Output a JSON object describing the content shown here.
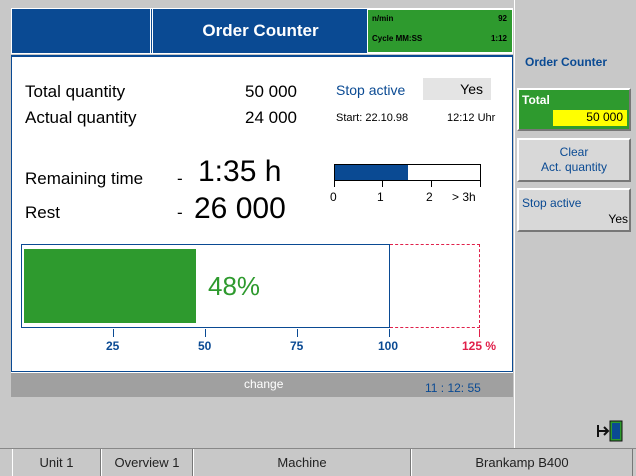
{
  "header": {
    "title": "Order Counter",
    "stats": {
      "rate_label": "n/min",
      "rate_value": "92",
      "cycle_label": "Cycle  MM:SS",
      "cycle_value": "1:12"
    }
  },
  "main": {
    "total_label": "Total quantity",
    "total_value": "50 000",
    "actual_label": "Actual quantity",
    "actual_value": "24 000",
    "stop_label": "Stop active",
    "stop_value": "Yes",
    "start_text": "Start: 22.10.98",
    "start_time": "12:12 Uhr",
    "remaining_label": "Remaining time",
    "remaining_dash": "-",
    "remaining_value": "1:35 h",
    "rest_label": "Rest",
    "rest_dash": "-",
    "rest_value": "26 000",
    "time_scale": {
      "fill_fraction": 0.5,
      "ticks": [
        "0",
        "1",
        "2",
        "> 3h"
      ]
    },
    "progress": {
      "percent_label": "48%",
      "fill_percent": 48,
      "ticks": [
        "25",
        "50",
        "75",
        "100",
        "125 %"
      ]
    }
  },
  "status_bar": {
    "action": "change",
    "clock": "11 : 12: 55"
  },
  "right_panel": {
    "title": "Order Counter",
    "total_label": "Total",
    "total_value": "50 000",
    "clear_label_1": "Clear",
    "clear_label_2": "Act. quantity",
    "stop_label": "Stop active",
    "stop_value": "Yes"
  },
  "footer": {
    "tabs": [
      "Unit 1",
      "Overview 1",
      "Machine",
      "Brankamp B400"
    ]
  },
  "colors": {
    "header_blue": "#0a4a93",
    "progress_green": "#2e9a2e",
    "value_yellow": "#ffff00",
    "overflow_red": "#e0204a"
  },
  "icons": [
    "exit-door-icon"
  ]
}
